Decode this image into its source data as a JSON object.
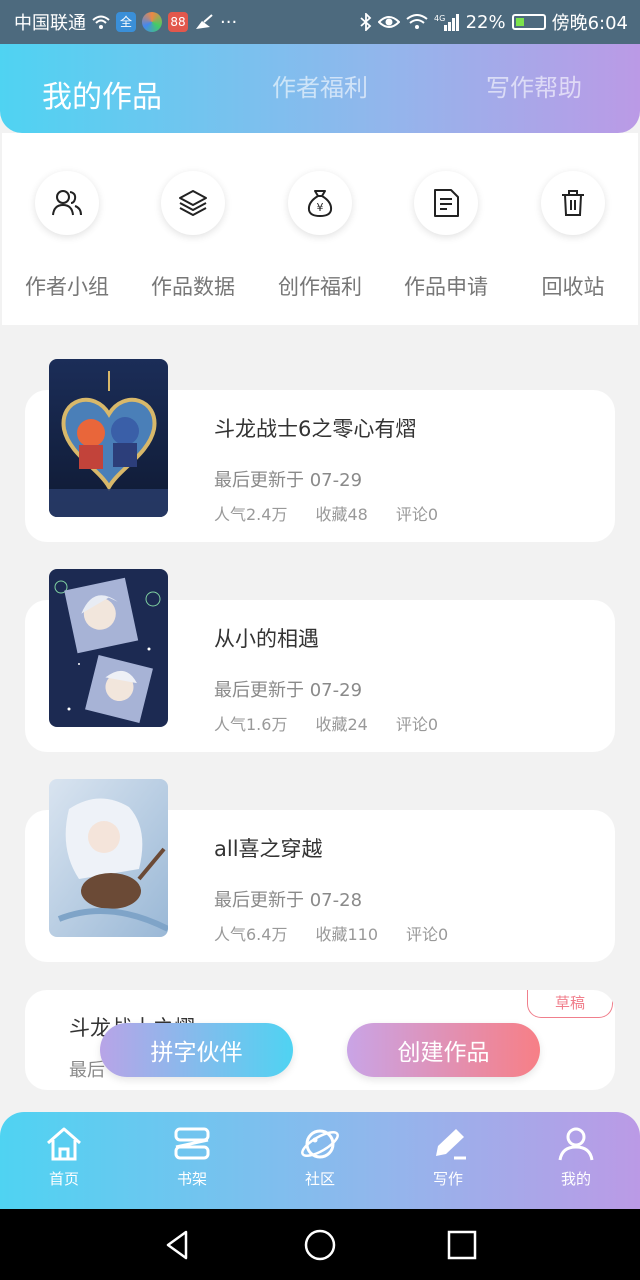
{
  "status_bar": {
    "carrier": "中国联通",
    "app_icons": [
      "全",
      "",
      "88"
    ],
    "more": "···",
    "battery": "22%",
    "time": "傍晚6:04"
  },
  "header": {
    "tabs": [
      {
        "label": "我的作品",
        "active": true
      },
      {
        "label": "作者福利",
        "active": false
      },
      {
        "label": "写作帮助",
        "active": false
      }
    ]
  },
  "quick_actions": [
    {
      "label": "作者小组",
      "icon": "people-icon"
    },
    {
      "label": "作品数据",
      "icon": "layers-icon"
    },
    {
      "label": "创作福利",
      "icon": "money-bag-icon"
    },
    {
      "label": "作品申请",
      "icon": "document-icon"
    },
    {
      "label": "回收站",
      "icon": "trash-icon"
    }
  ],
  "works": [
    {
      "title": "斗龙战士6之零心有熠",
      "update": "最后更新于 07-29",
      "popularity": "人气2.4万",
      "favorites": "收藏48",
      "comments": "评论0"
    },
    {
      "title": "从小的相遇",
      "update": "最后更新于 07-29",
      "popularity": "人气1.6万",
      "favorites": "收藏24",
      "comments": "评论0"
    },
    {
      "title": "all喜之穿越",
      "update": "最后更新于 07-28",
      "popularity": "人气6.4万",
      "favorites": "收藏110",
      "comments": "评论0"
    }
  ],
  "draft": {
    "badge": "草稿",
    "title": "斗龙战士之熠",
    "update": "最后"
  },
  "buttons": {
    "partner": "拼字伙伴",
    "create": "创建作品"
  },
  "tabbar": [
    {
      "label": "首页",
      "icon": "home-icon"
    },
    {
      "label": "书架",
      "icon": "bookshelf-icon"
    },
    {
      "label": "社区",
      "icon": "planet-icon"
    },
    {
      "label": "写作",
      "icon": "pen-icon"
    },
    {
      "label": "我的",
      "icon": "user-icon"
    }
  ],
  "colors": {
    "gradient_start": "#4fd3f2",
    "gradient_end": "#bb9ae6",
    "create_end": "#f77f86",
    "status_bg": "#4d6a7e"
  }
}
